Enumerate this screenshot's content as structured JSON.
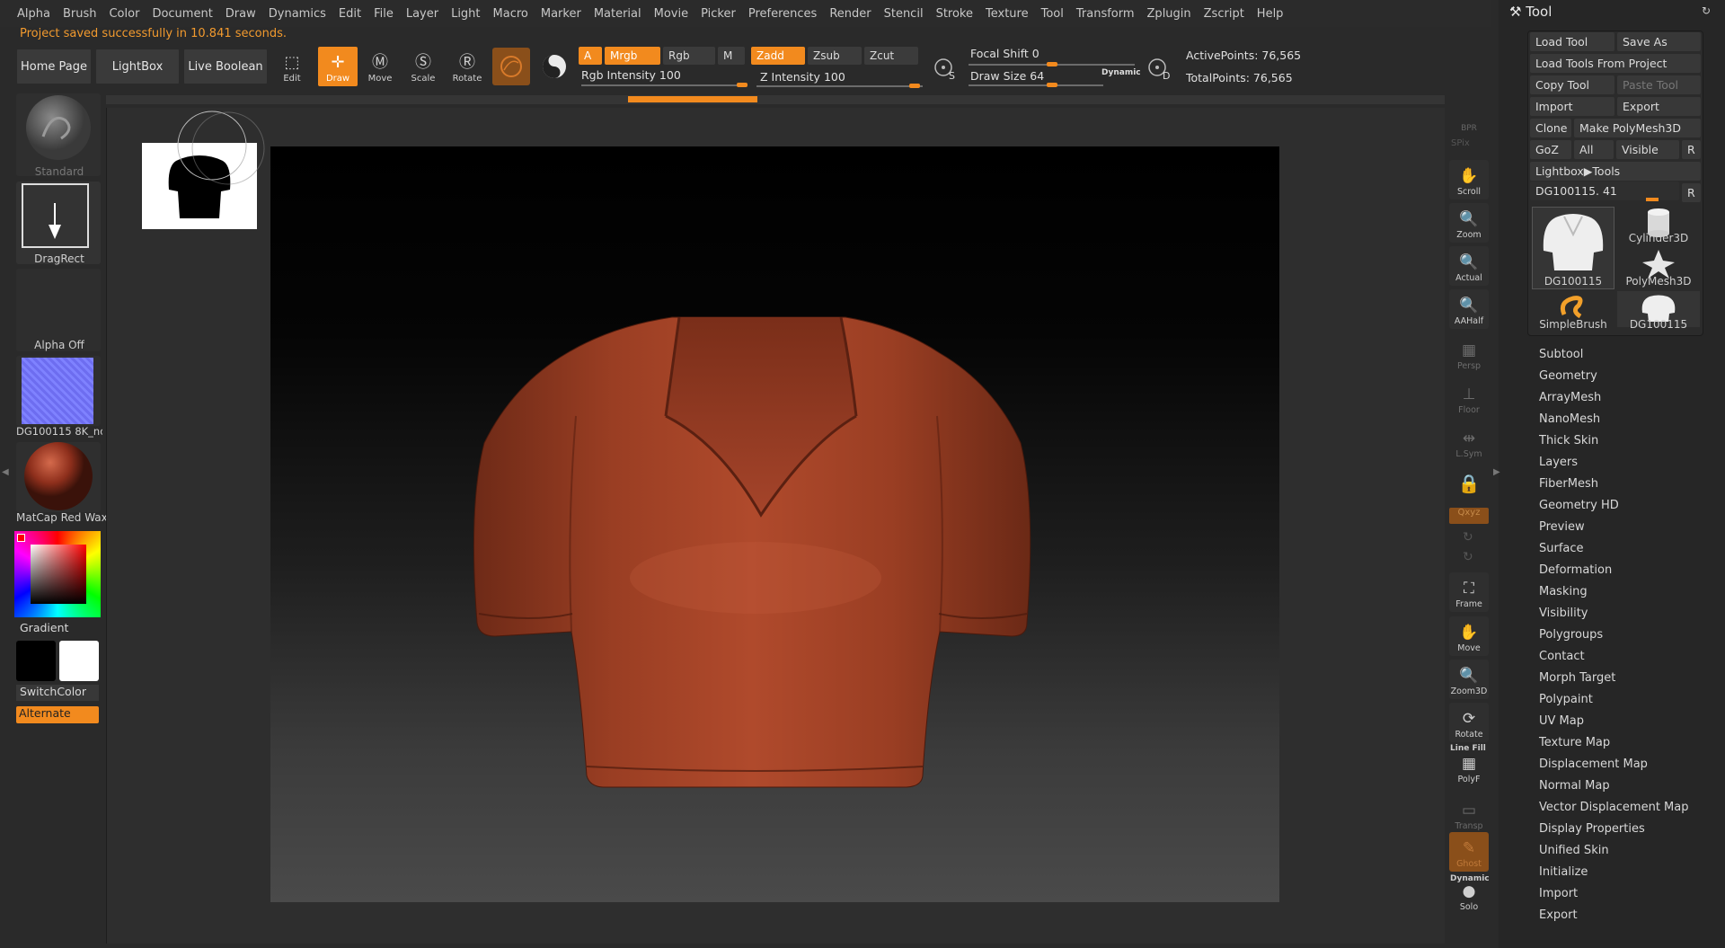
{
  "menu": [
    "Alpha",
    "Brush",
    "Color",
    "Document",
    "Draw",
    "Dynamics",
    "Edit",
    "File",
    "Layer",
    "Light",
    "Macro",
    "Marker",
    "Material",
    "Movie",
    "Picker",
    "Preferences",
    "Render",
    "Stencil",
    "Stroke",
    "Texture",
    "Tool",
    "Transform",
    "Zplugin",
    "Zscript",
    "Help"
  ],
  "status_message": "Project saved successfully in 10.841 seconds.",
  "toolbar": {
    "home_page": "Home Page",
    "lightbox": "LightBox",
    "live_boolean": "Live Boolean",
    "edit": "Edit",
    "draw": "Draw",
    "move": "Move",
    "scale": "Scale",
    "rotate": "Rotate",
    "a": "A",
    "mrgb": "Mrgb",
    "rgb": "Rgb",
    "m": "M",
    "zadd": "Zadd",
    "zsub": "Zsub",
    "zcut": "Zcut",
    "rgb_intensity_label": "Rgb Intensity",
    "rgb_intensity": "100",
    "z_intensity_label": "Z Intensity",
    "z_intensity": "100",
    "focal_shift_label": "Focal Shift",
    "focal_shift": "0",
    "draw_size_label": "Draw Size",
    "draw_size": "64",
    "dynamic": "Dynamic",
    "active_points": "ActivePoints: 76,565",
    "total_points": "TotalPoints: 76,565",
    "s_label": "S",
    "d_label": "D"
  },
  "left_panel": {
    "brush": "Standard",
    "stroke": "DragRect",
    "alpha": "Alpha Off",
    "texture": "DG100115 8K_no",
    "material": "MatCap Red Wax",
    "gradient": "Gradient",
    "switch_color": "SwitchColor",
    "alternate": "Alternate"
  },
  "right_dock": [
    {
      "label": "BPR",
      "dim": true
    },
    {
      "label": "Scroll",
      "dim": false
    },
    {
      "label": "Zoom",
      "dim": false
    },
    {
      "label": "Actual",
      "dim": false
    },
    {
      "label": "AAHalf",
      "dim": false
    },
    {
      "label": "Persp",
      "dim": true
    },
    {
      "label": "Floor",
      "dim": true
    },
    {
      "label": "L.Sym",
      "dim": true
    },
    {
      "label": "Frame",
      "dim": false
    },
    {
      "label": "Move",
      "dim": false
    },
    {
      "label": "Zoom3D",
      "dim": false
    },
    {
      "label": "Rotate",
      "dim": false
    },
    {
      "label": "PolyF",
      "dim": false
    },
    {
      "label": "Transp",
      "dim": true
    },
    {
      "label": "Ghost",
      "dim": true
    },
    {
      "label": "Solo",
      "dim": false
    }
  ],
  "right_dock_extra": {
    "spix": "SPix",
    "xyz": "Qxyz",
    "line_fill": "Line Fill",
    "dynamic": "Dynamic"
  },
  "tool_palette": {
    "title": "Tool",
    "load_tool": "Load Tool",
    "save_as": "Save As",
    "load_tools_from_project": "Load Tools From Project",
    "copy_tool": "Copy Tool",
    "paste_tool": "Paste Tool",
    "import": "Import",
    "export": "Export",
    "clone": "Clone",
    "make_polymesh": "Make PolyMesh3D",
    "goz": "GoZ",
    "all": "All",
    "visible": "Visible",
    "r": "R",
    "lightbox_tools": "Lightbox▶Tools",
    "current_tool": "DG100115. 41",
    "thumbs": [
      "DG100115",
      "Cylinder3D",
      "PolyMesh3D",
      "SimpleBrush",
      "DG100115"
    ],
    "subpalettes": [
      "Subtool",
      "Geometry",
      "ArrayMesh",
      "NanoMesh",
      "Thick Skin",
      "Layers",
      "FiberMesh",
      "Geometry HD",
      "Preview",
      "Surface",
      "Deformation",
      "Masking",
      "Visibility",
      "Polygroups",
      "Contact",
      "Morph Target",
      "Polypaint",
      "UV Map",
      "Texture Map",
      "Displacement Map",
      "Normal Map",
      "Vector Displacement Map",
      "Display Properties",
      "Unified Skin",
      "Initialize",
      "Import",
      "Export"
    ]
  },
  "colors": {
    "accent": "#f28a1e",
    "shirt": "#9b3f24",
    "background": "#2a2a2a"
  }
}
